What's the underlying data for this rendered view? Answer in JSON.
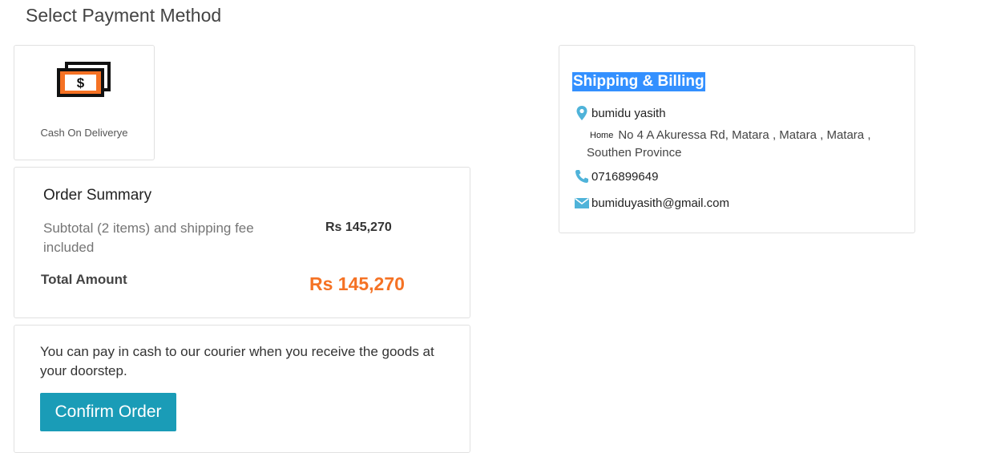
{
  "page": {
    "title": "Select Payment Method"
  },
  "payment_method": {
    "label": "Cash On Deliverye",
    "icon": "cash-icon",
    "icon_symbol": "$",
    "icon_colors": {
      "accent": "#f57224",
      "outline": "#111111"
    }
  },
  "order_summary": {
    "title": "Order Summary",
    "subtotal_label": "Subtotal (2 items) and shipping fee included",
    "subtotal_value": "Rs 145,270",
    "total_label": "Total Amount",
    "total_value": "Rs 145,270"
  },
  "confirm": {
    "note": "You can pay in cash to our courier when you receive the goods at your doorstep.",
    "button_label": "Confirm Order"
  },
  "shipping": {
    "title": "Shipping & Billing",
    "name": "bumidu yasith",
    "address_tag": "Home",
    "address": "No 4 A Akuressa Rd, Matara , Matara , Matara , Southen Province",
    "phone": "0716899649",
    "email": "bumiduyasith@gmail.com",
    "icon_color": "#4fb3d9"
  },
  "colors": {
    "brand_orange": "#f57224",
    "button_teal": "#1a9cb7",
    "selection_blue": "#3390ff"
  }
}
